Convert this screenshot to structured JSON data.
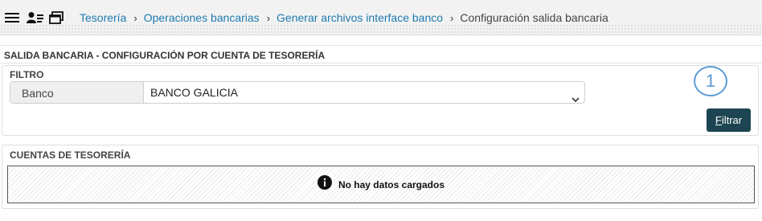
{
  "topbar": {
    "icons": [
      "menu-icon",
      "user-card-icon",
      "windows-icon"
    ],
    "breadcrumb": [
      {
        "label": "Tesorería",
        "link": true
      },
      {
        "label": "Operaciones bancarias",
        "link": true
      },
      {
        "label": "Generar archivos interface banco",
        "link": true
      },
      {
        "label": "Configuración salida bancaria",
        "link": false
      }
    ],
    "separator": "›"
  },
  "page": {
    "title": "SALIDA BANCARIA - CONFIGURACIÓN POR CUENTA DE TESORERÍA"
  },
  "filter": {
    "title": "FILTRO",
    "bank_label": "Banco",
    "bank_value": "BANCO GALICIA",
    "step_number": "1",
    "button_underlined": "F",
    "button_rest": "iltrar"
  },
  "accounts": {
    "title": "CUENTAS DE TESORERÍA",
    "empty_message": "No hay datos cargados"
  },
  "colors": {
    "link": "#1e7bb0",
    "button": "#1d4551",
    "step": "#5b9bd5"
  }
}
